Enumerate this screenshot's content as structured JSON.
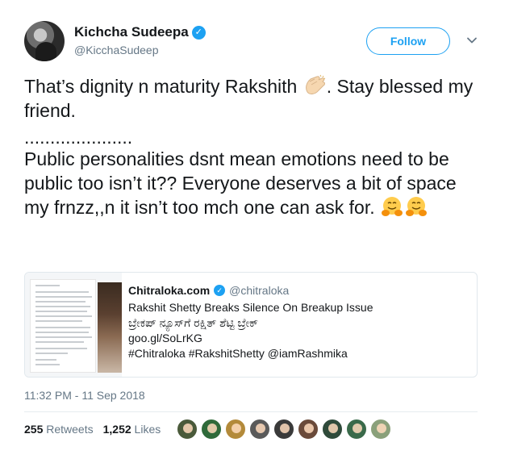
{
  "author": {
    "display_name": "Kichcha Sudeepa",
    "handle": "@KicchaSudeep",
    "verified_glyph": "✓"
  },
  "follow_button": {
    "label": "Follow"
  },
  "tweet": {
    "line1": "That’s dignity n maturity Rakshith ",
    "line1_end": ". Stay blessed my friend.",
    "dots": ".....................",
    "line2": "Public personalities dsnt mean emotions need to be public too isn’t it?? Everyone deserves a bit of space my frnzz,,n it isn’t too mch one can ask for. ",
    "emojis": [
      "clapping-hands-emoji",
      "hugging-face-emoji",
      "hugging-face-emoji"
    ]
  },
  "quote": {
    "name": "Chitraloka.com",
    "handle": "@chitraloka",
    "lines": [
      "Rakshit Shetty Breaks Silence On Breakup Issue",
      "ಬ್ರೇಕಪ್ ನ್ಯೂಸ್‌ಗೆ ರಕ್ಷಿತ್ ಶೆಟ್ಟಿ ಬ್ರೇಕ್",
      "goo.gl/SoLrKG",
      "#Chitraloka #RakshitShetty @iamRashmika"
    ]
  },
  "timestamp": "11:32 PM - 11 Sep 2018",
  "stats": {
    "retweets_count": "255",
    "retweets_label": "Retweets",
    "likes_count": "1,252",
    "likes_label": "Likes"
  },
  "colors": {
    "accent": "#1da1f2",
    "muted": "#657786",
    "text": "#14171a",
    "border": "#e1e8ed"
  },
  "liker_avatar_colors": [
    "#4a5a3a",
    "#2f6a3a",
    "#b38a3a",
    "#5a5a5a",
    "#3a3a3a",
    "#6a4a3a",
    "#2f4a3a",
    "#3a6a4a",
    "#8aa07a"
  ]
}
